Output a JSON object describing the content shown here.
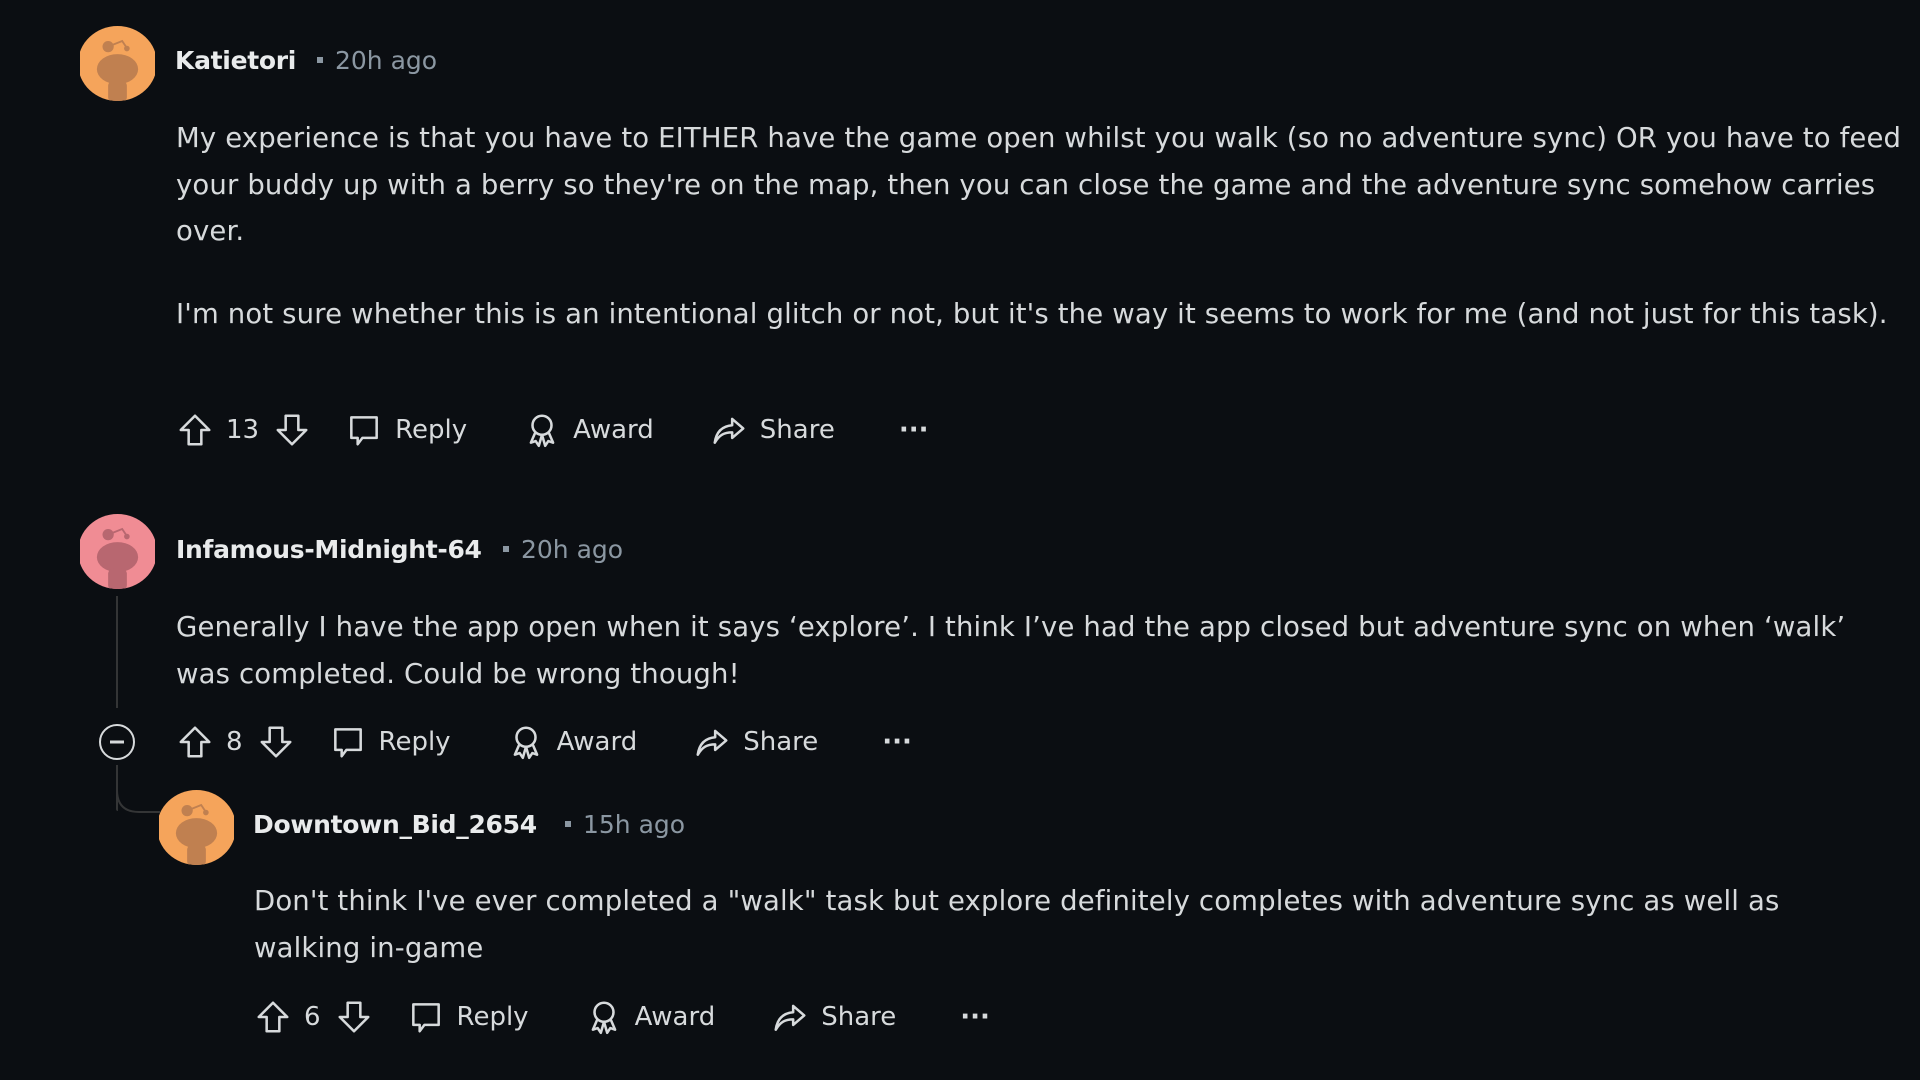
{
  "comments": [
    {
      "username": "Katietori",
      "timestamp": "20h ago",
      "avatar_color": "#f5a45b",
      "avatar_figure_color": "#c08050",
      "avatar_icon": "reddit-snoo-avatar",
      "body": [
        "My experience is that you have to EITHER have the game open whilst you walk (so no adventure sync) OR you have to feed your buddy up with a berry so they're on the map, then you can close the game and the adventure sync somehow carries over.",
        "I'm not sure whether this is an intentional glitch or not, but it's the way it seems to work for me (and not just for this task)."
      ],
      "score": "13",
      "actions": {
        "reply": "Reply",
        "award": "Award",
        "share": "Share",
        "more": "···"
      }
    },
    {
      "username": "Infamous-Midnight-64",
      "timestamp": "20h ago",
      "avatar_color": "#f08c94",
      "avatar_figure_color": "#b86770",
      "avatar_icon": "reddit-snoo-avatar",
      "body": [
        "Generally I have the app open when it says ‘explore’. I think I’ve had the app closed but adventure sync on when ‘walk’ was completed. Could be wrong though!"
      ],
      "score": "8",
      "actions": {
        "reply": "Reply",
        "award": "Award",
        "share": "Share",
        "more": "···"
      }
    },
    {
      "username": "Downtown_Bid_2654",
      "timestamp": "15h ago",
      "avatar_color": "#f5a45b",
      "avatar_figure_color": "#c08050",
      "avatar_icon": "reddit-snoo-avatar",
      "body": [
        "Don't think I've ever completed a \"walk\" task but explore definitely completes with adventure sync as well as walking in-game"
      ],
      "score": "6",
      "actions": {
        "reply": "Reply",
        "award": "Award",
        "share": "Share",
        "more": "···"
      }
    }
  ],
  "theme": {
    "background": "#0b0e12",
    "text": "#d7dadc",
    "muted": "#8b97a2",
    "thread_line": "#343536"
  }
}
